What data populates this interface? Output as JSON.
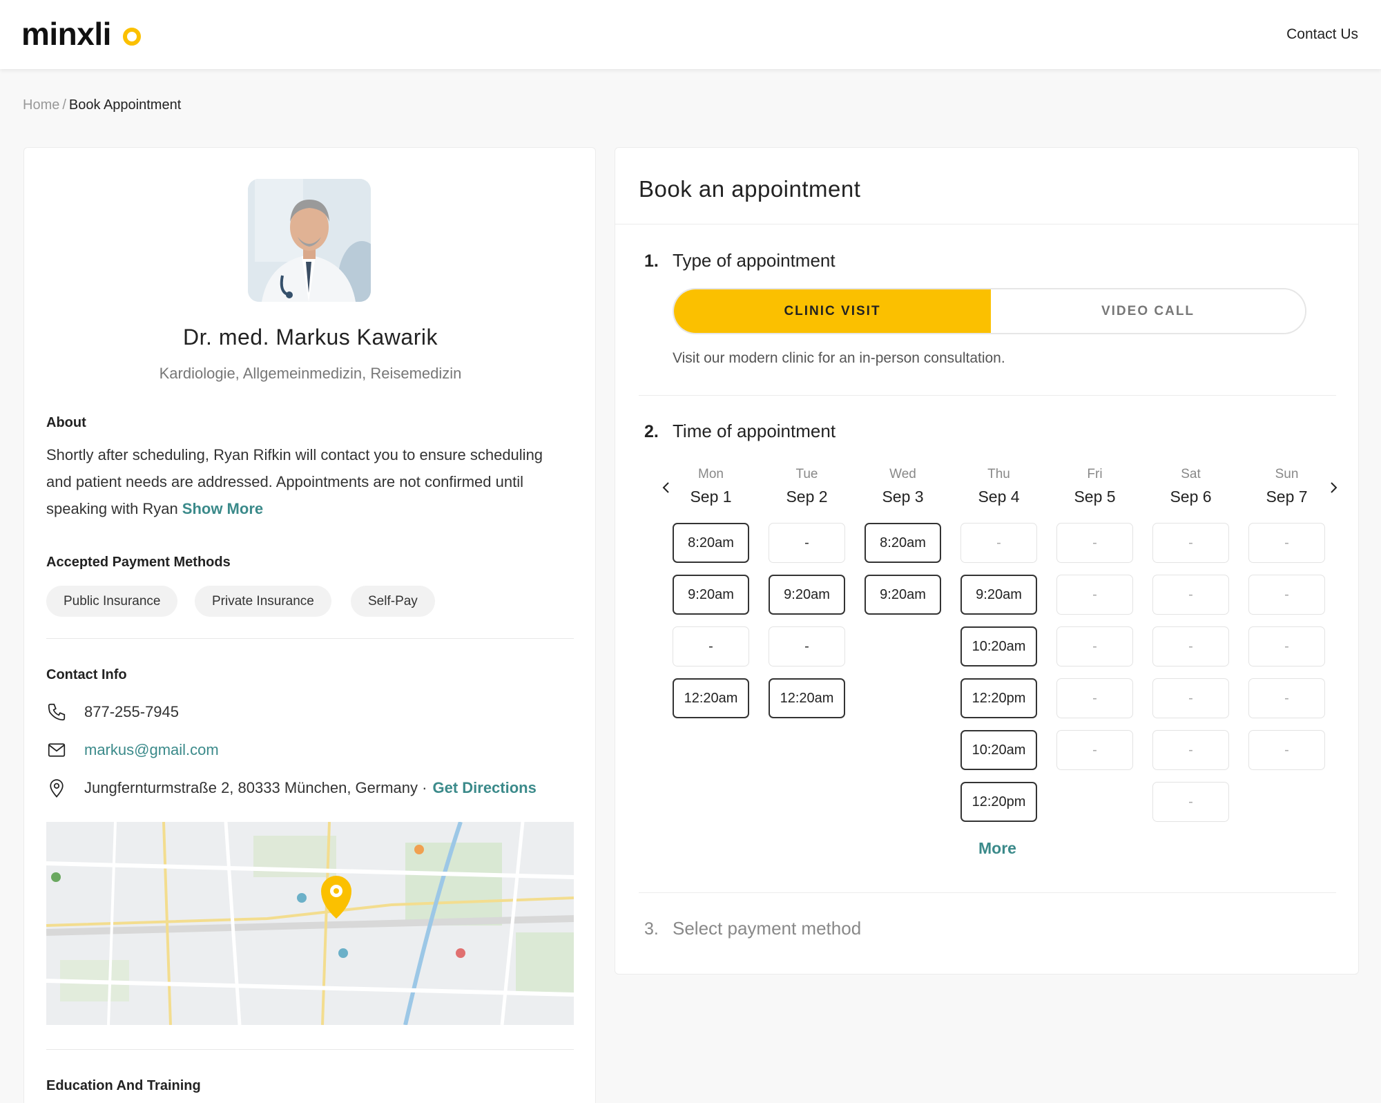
{
  "header": {
    "logo": "minxli",
    "contact_label": "Contact Us"
  },
  "breadcrumb": {
    "home": "Home",
    "separator": "/",
    "current": "Book Appointment"
  },
  "doctor": {
    "name": "Dr. med. Markus Kawarik",
    "specialties": "Kardiologie, Allgemeinmedizin, Reisemedizin"
  },
  "about": {
    "title": "About",
    "text": "Shortly after scheduling, Ryan Rifkin will contact you to ensure scheduling and patient needs are addressed. Appointments are not confirmed until speaking with Ryan",
    "show_more": "Show More"
  },
  "payment": {
    "title": "Accepted Payment Methods",
    "methods": [
      "Public Insurance",
      "Private Insurance",
      "Self-Pay"
    ]
  },
  "contact": {
    "title": "Contact Info",
    "phone": "877-255-7945",
    "email": "markus@gmail.com",
    "address": "Jungfernturmstraße 2, 80333 München, Germany ·",
    "directions": "Get Directions"
  },
  "education": {
    "title": "Education And Training"
  },
  "booking": {
    "title": "Book an appointment",
    "step1": {
      "num": "1.",
      "label": "Type of appointment"
    },
    "types": {
      "active": "CLINIC VISIT",
      "inactive": "VIDEO CALL"
    },
    "type_description": "Visit our modern clinic for an in-person consultation.",
    "step2": {
      "num": "2.",
      "label": "Time of appointment"
    },
    "days": [
      {
        "name": "Mon",
        "date": "Sep 1"
      },
      {
        "name": "Tue",
        "date": "Sep 2"
      },
      {
        "name": "Wed",
        "date": "Sep 3"
      },
      {
        "name": "Thu",
        "date": "Sep 4"
      },
      {
        "name": "Fri",
        "date": "Sep 5"
      },
      {
        "name": "Sat",
        "date": "Sep 6"
      },
      {
        "name": "Sun",
        "date": "Sep 7"
      }
    ],
    "slots": {
      "mon": [
        "8:20am",
        "9:20am",
        "-",
        "12:20am"
      ],
      "tue": [
        "-",
        "9:20am",
        "-",
        "12:20am"
      ],
      "wed": [
        "8:20am",
        "9:20am"
      ],
      "thu": [
        "-",
        "9:20am",
        "10:20am",
        "12:20pm",
        "10:20am",
        "12:20pm"
      ],
      "fri": [
        "-",
        "-",
        "-",
        "-",
        "-"
      ],
      "sat": [
        "-",
        "-",
        "-",
        "-",
        "-",
        "-"
      ],
      "sun": [
        "-",
        "-",
        "-",
        "-",
        "-"
      ]
    },
    "more": "More",
    "step3": {
      "num": "3.",
      "label": "Select payment method"
    }
  },
  "colors": {
    "accent": "#fbc000",
    "link": "#3b8a8a",
    "text": "#222222"
  }
}
